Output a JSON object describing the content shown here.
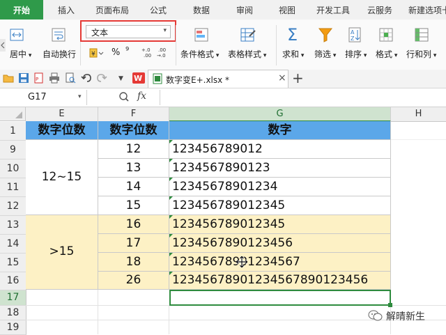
{
  "ribbon_tabs": [
    "开始",
    "插入",
    "页面布局",
    "公式",
    "数据",
    "审阅",
    "视图",
    "开发工具",
    "云服务",
    "新建选项卡"
  ],
  "ribbon": {
    "align_label": "居中",
    "wrap_label": "自动换行",
    "number_format": "文本",
    "percent_symbol": "%",
    "comma_symbol": "⁹",
    "inc_decimal": "+.0 .00",
    "dec_decimal": ".00 →.0",
    "cond_format": "条件格式",
    "table_style": "表格样式",
    "sum": "求和",
    "filter": "筛选",
    "sort": "排序",
    "format": "格式",
    "rows_cols": "行和列"
  },
  "file_tab": "数字变E+.xlsx *",
  "name_box": "G17",
  "fx": "fx",
  "columns": [
    "E",
    "F",
    "G",
    "H"
  ],
  "rows": [
    "1",
    "9",
    "10",
    "11",
    "12",
    "13",
    "14",
    "15",
    "16",
    "17",
    "18",
    "19"
  ],
  "table": {
    "headers": [
      "数字位数",
      "数字位数",
      "数字"
    ],
    "group1": "12~15",
    "group2": ">15",
    "digits": [
      "12",
      "13",
      "14",
      "15",
      "16",
      "17",
      "18",
      "26"
    ],
    "numbers": [
      "123456789012",
      "1234567890123",
      "12345678901234",
      "123456789012345",
      "123456789012345",
      "1234567890123456",
      "12345678901234567",
      "12345678901234567890123456"
    ]
  },
  "watermark": "解晴新生",
  "colors": {
    "accent_green": "#2f9a4a",
    "header_blue": "#5ba7e9",
    "highlight_yellow": "#fdf1c5",
    "annotation_red": "#e53935"
  }
}
